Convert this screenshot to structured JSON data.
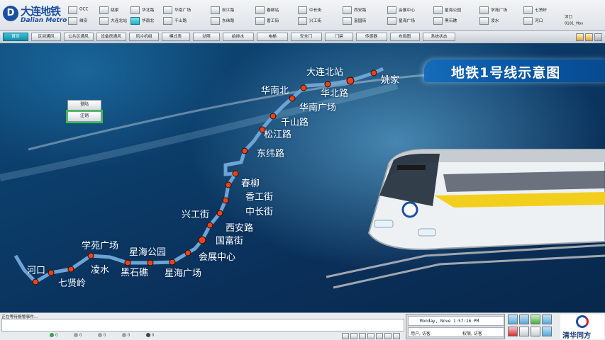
{
  "app": {
    "logo_cn": "大连地铁",
    "logo_en": "Dalian Metro",
    "logo_mark": "D"
  },
  "header_stations": {
    "row1": [
      "OCC",
      "姚家",
      "华北路",
      "华南广场",
      "松江路",
      "春柳站",
      "中长街",
      "西安路",
      "会展中心",
      "星海公园",
      "学苑广场",
      "七贤岭"
    ],
    "row2": [
      "维安",
      "大连北站",
      "华南北",
      "千山路",
      "东纬路",
      "香工街",
      "兴工街",
      "富国街",
      "星海广场",
      "黑石礁",
      "凌水",
      "河口"
    ],
    "active_station_index": 2
  },
  "header_info": {
    "line1": "河口",
    "line2": "0101_Max"
  },
  "nav": {
    "tabs": [
      "首页",
      "区间通风",
      "公共区通风",
      "设备房通风",
      "风冷机组",
      "模式表",
      "动照",
      "给排水",
      "电梯",
      "安全门",
      "门禁",
      "传感器",
      "布局图",
      "系统状态"
    ],
    "active_index": 0
  },
  "title": "地铁1号线示意图",
  "side_buttons": [
    "登陆",
    "注销"
  ],
  "map_stations": [
    {
      "name": "姚家"
    },
    {
      "name": "大连北站"
    },
    {
      "name": "华北路"
    },
    {
      "name": "华南北"
    },
    {
      "name": "华南广场"
    },
    {
      "name": "千山路"
    },
    {
      "name": "松江路"
    },
    {
      "name": "东纬路"
    },
    {
      "name": "春柳"
    },
    {
      "name": "香工街"
    },
    {
      "name": "中长街"
    },
    {
      "name": "兴工街"
    },
    {
      "name": "西安路"
    },
    {
      "name": "国富街"
    },
    {
      "name": "会展中心"
    },
    {
      "name": "星海广场"
    },
    {
      "name": "星海公园"
    },
    {
      "name": "黑石礁"
    },
    {
      "name": "学苑广场"
    },
    {
      "name": "凌水"
    },
    {
      "name": "七贤岭"
    },
    {
      "name": "河口"
    }
  ],
  "colors": {
    "line": "#6ea4d4",
    "station_dot": "#e8431c",
    "banner": "#0a5aa8",
    "nav_active": "#138ea8",
    "select_outline": "#33c44a"
  },
  "status": {
    "alarm_text": "正在等待报警事件...",
    "counters": [
      "0",
      "0",
      "0",
      "0",
      "0"
    ],
    "datetime": "Monday, Nove    1:57:16 PM",
    "user_label": "用户, 访客",
    "permission_label": "权限, 访客",
    "vendor": "清华同方"
  }
}
